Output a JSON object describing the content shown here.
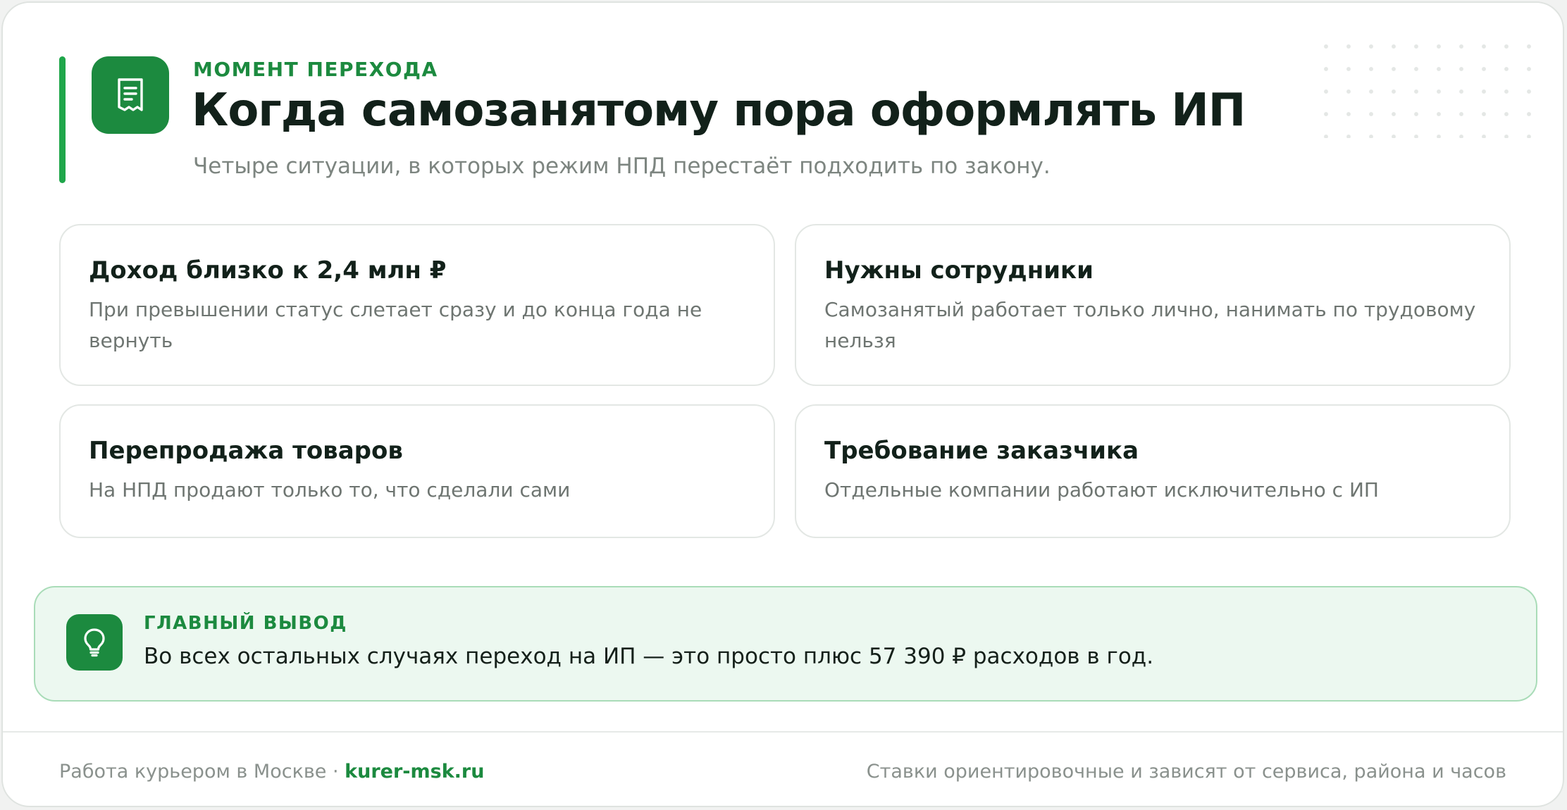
{
  "header": {
    "eyebrow": "МОМЕНТ ПЕРЕХОДА",
    "title": "Когда самозанятому пора оформлять ИП",
    "subtitle": "Четыре ситуации, в которых режим НПД перестаёт подходить по закону.",
    "icon": "receipt-icon"
  },
  "situations": [
    {
      "title": "Доход близко к 2,4 млн ₽",
      "text": "При превышении статус слетает сразу и до конца года не вернуть"
    },
    {
      "title": "Нужны сотрудники",
      "text": "Самозанятый работает только лично, нанимать по трудовому нельзя"
    },
    {
      "title": "Перепродажа товаров",
      "text": "На НПД продают только то, что сделали сами"
    },
    {
      "title": "Требование заказчика",
      "text": "Отдельные компании работают исключительно с ИП"
    }
  ],
  "takeaway": {
    "label": "ГЛАВНЫЙ ВЫВОД",
    "text": "Во всех остальных случаях переход на ИП — это просто плюс 57 390 ₽ расходов в год.",
    "icon": "lightbulb-icon"
  },
  "footer": {
    "left_text": "Работа курьером в Москве ·",
    "link_text": "kurer-msk.ru",
    "right_text": "Ставки ориентировочные и зависят от сервиса, района и часов"
  },
  "colors": {
    "accent": "#1c8a3f",
    "accent_bar": "#1fa64a",
    "takeaway_bg": "#ecf8f0",
    "takeaway_border": "#a9dcb8"
  }
}
